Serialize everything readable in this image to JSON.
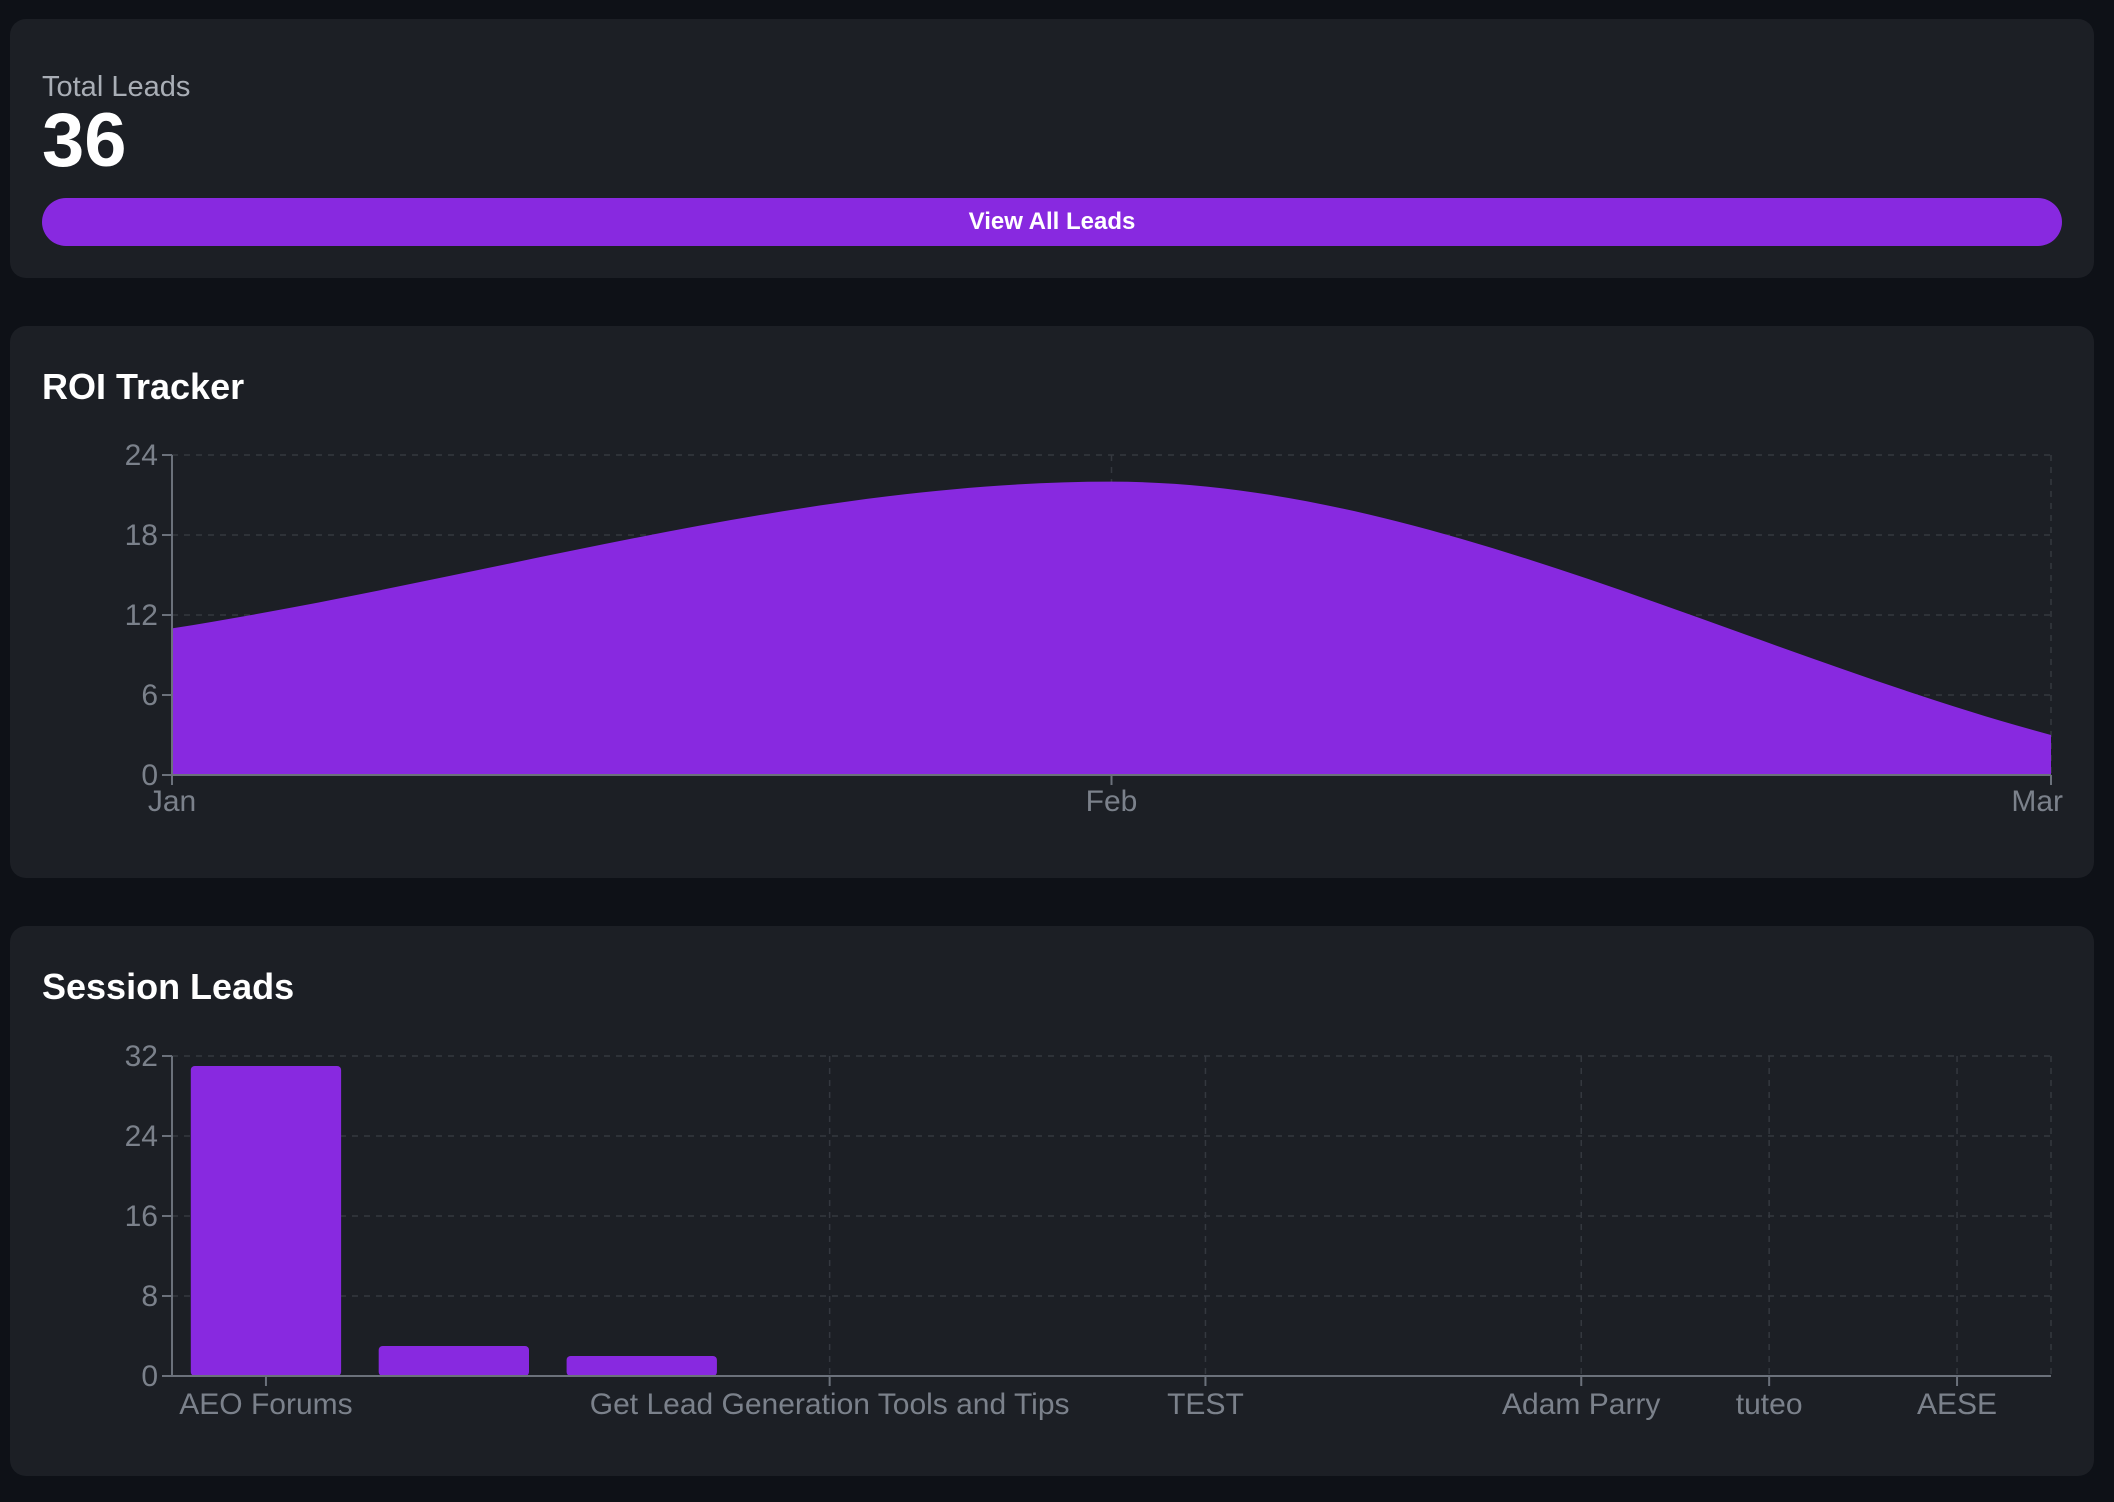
{
  "total_leads": {
    "label": "Total Leads",
    "value": "36",
    "button_label": "View All Leads"
  },
  "roi": {
    "title": "ROI Tracker"
  },
  "session": {
    "title": "Session Leads"
  },
  "colors": {
    "accent": "#8829e0",
    "card_bg": "#1c1f25",
    "page_bg": "#0e1117",
    "tick_text": "#7b818b"
  },
  "chart_data": [
    {
      "type": "area",
      "title": "ROI Tracker",
      "categories": [
        "Jan",
        "Feb",
        "Mar"
      ],
      "values": [
        11,
        22,
        3
      ],
      "ylim": [
        0,
        24
      ],
      "yticks": [
        0,
        6,
        12,
        18,
        24
      ],
      "grid": true,
      "curve": "smooth"
    },
    {
      "type": "bar",
      "title": "Session Leads",
      "categories": [
        "AEO Forums",
        "",
        "Get Lead Generation Tools and Tips",
        "",
        "TEST",
        "",
        "Adam Parry",
        "tuteo",
        "AESE",
        "",
        ""
      ],
      "x_tick_labels": [
        "AEO Forums",
        "Get Lead Generation Tools and Tips",
        "TEST",
        "Adam Parry",
        "tuteo",
        "AESE"
      ],
      "values": [
        31,
        3,
        2,
        0,
        0,
        0,
        0,
        0,
        0,
        0
      ],
      "ylim": [
        0,
        32
      ],
      "yticks": [
        0,
        8,
        16,
        24,
        32
      ],
      "grid": true
    }
  ]
}
